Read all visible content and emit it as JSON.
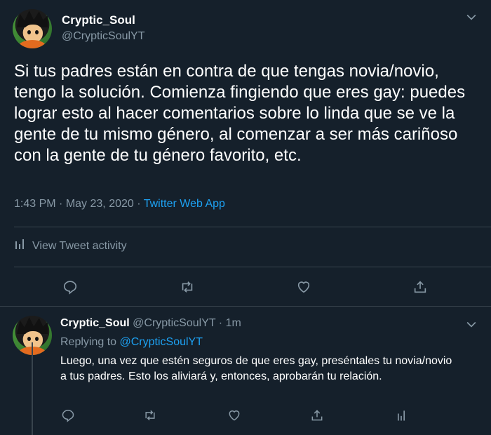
{
  "main_tweet": {
    "display_name": "Cryptic_Soul",
    "handle": "@CrypticSoulYT",
    "text": "Si tus padres están en contra de que tengas novia/novio, tengo la solución. Comienza fingiendo que eres gay: puedes lograr esto al hacer comentarios sobre lo linda que se ve la gente de tu mismo género, al comenzar a ser más cariñoso con la gente de tu género favorito, etc.",
    "time": "1:43 PM",
    "date": "May 23, 2020",
    "separator": "·",
    "source": "Twitter Web App",
    "activity_label": "View Tweet activity"
  },
  "reply_tweet": {
    "display_name": "Cryptic_Soul",
    "handle": "@CrypticSoulYT",
    "separator": "·",
    "age": "1m",
    "replying_prefix": "Replying to",
    "replying_to": "@CrypticSoulYT",
    "text": "Luego, una vez que estén seguros de que eres gay, preséntales tu novia/novio a tus padres. Esto los aliviará y, entonces, aprobarán tu relación."
  },
  "colors": {
    "background": "#15202b",
    "text_primary": "#ffffff",
    "text_secondary": "#8899a6",
    "accent": "#1da1f2",
    "divider": "#38444d"
  },
  "icons": [
    "chevron-down-icon",
    "bar-chart-icon",
    "reply-icon",
    "retweet-icon",
    "like-icon",
    "share-icon"
  ]
}
